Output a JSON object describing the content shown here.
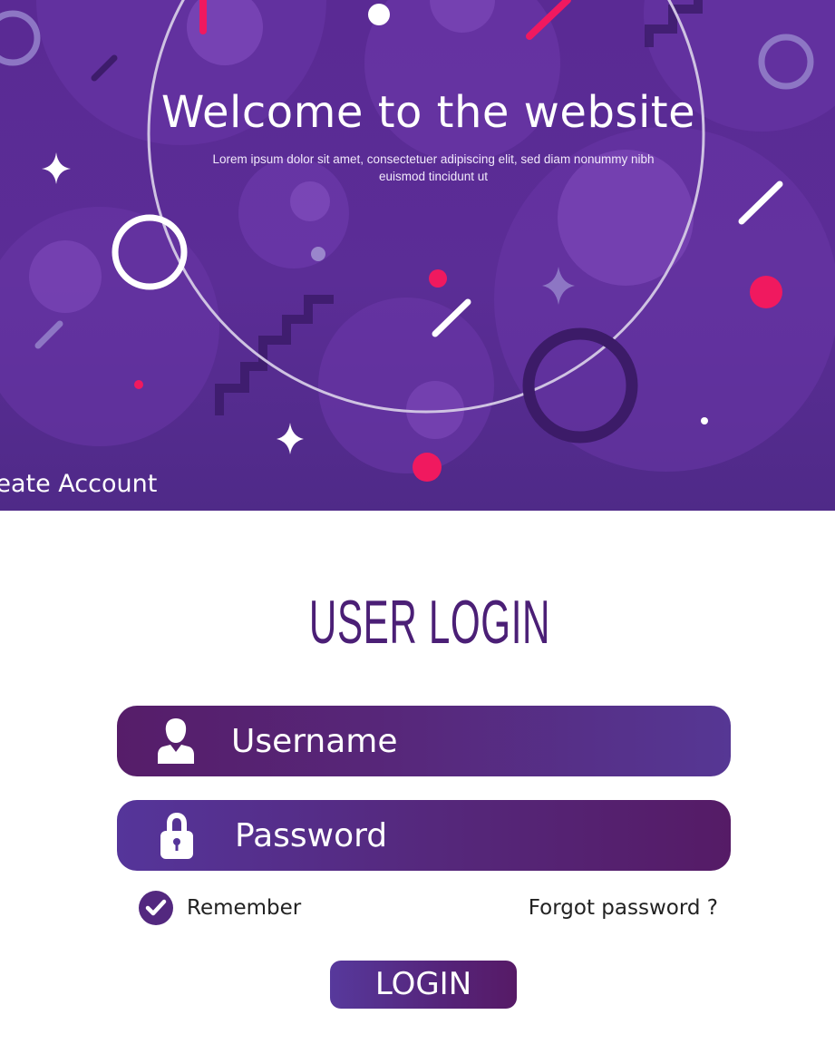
{
  "hero": {
    "title": "Welcome to the website",
    "subtitle": "Lorem ipsum dolor sit amet, consectetuer adipiscing elit, sed diam nonummy nibh euismod tincidunt ut",
    "create_account": "Create Account"
  },
  "login": {
    "title": "USER LOGIN",
    "username_placeholder": "Username",
    "password_placeholder": "Password",
    "remember_label": "Remember",
    "remember_checked": true,
    "forgot_label": "Forgot password ?",
    "login_button": "LOGIN"
  },
  "icons": {
    "username": "user-icon",
    "password": "lock-icon",
    "remember": "checkmark-icon"
  },
  "colors": {
    "hero_background": "#5a2a94",
    "accent_pink": "#f0195f",
    "brand_purple": "#4b1f76",
    "field_dark": "#561d69",
    "field_light": "#563794",
    "text_dark": "#222222"
  }
}
